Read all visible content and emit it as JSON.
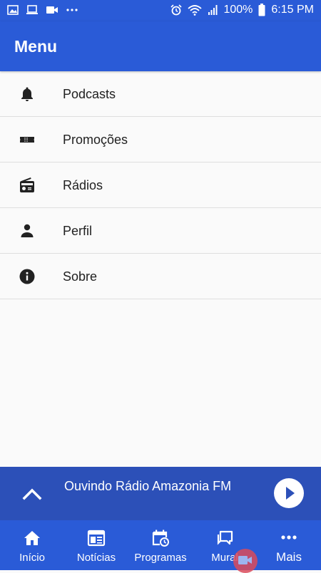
{
  "status_bar": {
    "icons_left": [
      "image-icon",
      "laptop-icon",
      "video-camera-icon",
      "more-notifications-icon"
    ],
    "icons_right": [
      "alarm-icon",
      "wifi-icon",
      "signal-icon",
      "battery-icon"
    ],
    "battery": "100%",
    "time": "6:15 PM"
  },
  "app_bar": {
    "title": "Menu"
  },
  "menu": {
    "items": [
      {
        "label": "Podcasts",
        "icon": "bell-icon"
      },
      {
        "label": "Promoções",
        "icon": "ticket-icon"
      },
      {
        "label": "Rádios",
        "icon": "radio-icon"
      },
      {
        "label": "Perfil",
        "icon": "person-icon"
      },
      {
        "label": "Sobre",
        "icon": "info-icon"
      }
    ]
  },
  "player": {
    "title": "Ouvindo Rádio Amazonia FM",
    "expand_icon": "chevron-up-icon",
    "play_icon": "play-icon"
  },
  "bottom_nav": {
    "items": [
      {
        "label": "Início",
        "icon": "home-icon"
      },
      {
        "label": "Notícias",
        "icon": "news-icon"
      },
      {
        "label": "Programas",
        "icon": "calendar-clock-icon"
      },
      {
        "label": "Mural",
        "icon": "chat-icon"
      },
      {
        "label": "Mais",
        "icon": "more-icon"
      }
    ]
  },
  "colors": {
    "primary": "#2a5bd7",
    "player_bg": "#2c50b8",
    "background": "#fafafa",
    "divider": "#dedede"
  }
}
